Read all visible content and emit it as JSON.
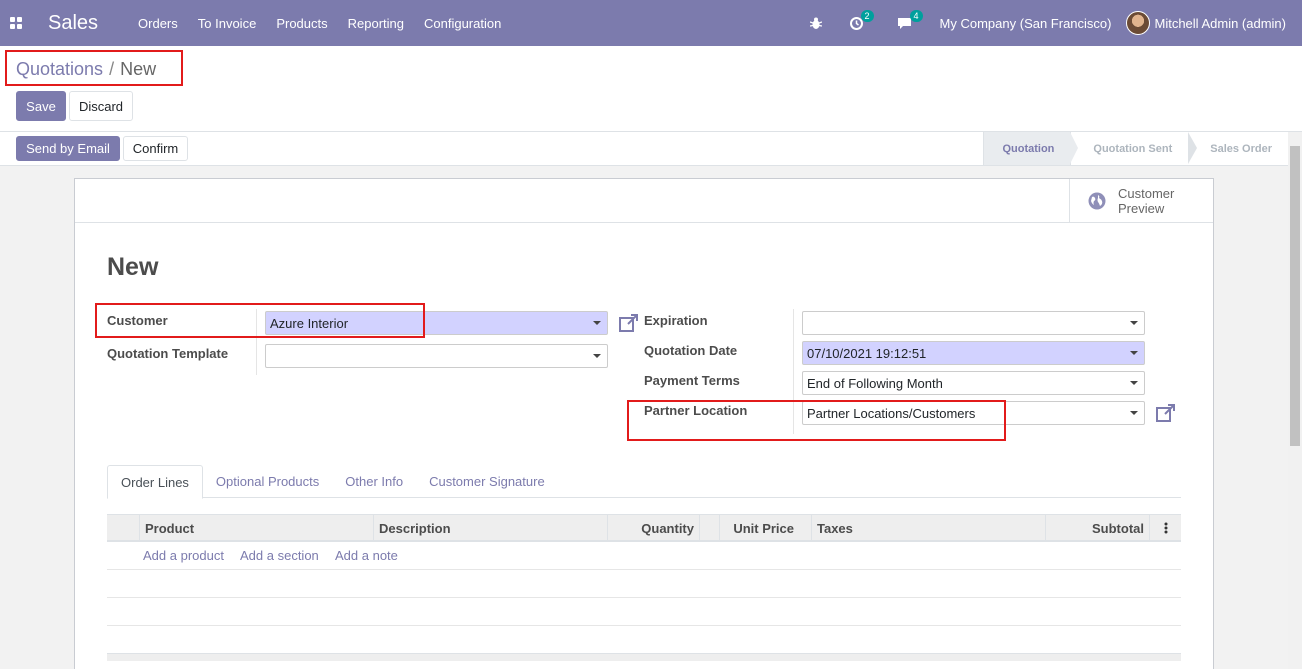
{
  "navbar": {
    "app_name": "Sales",
    "menu": [
      "Orders",
      "To Invoice",
      "Products",
      "Reporting",
      "Configuration"
    ],
    "activity_count": "2",
    "messages_count": "4",
    "company": "My Company (San Francisco)",
    "user": "Mitchell Admin (admin)"
  },
  "breadcrumb": {
    "parent": "Quotations",
    "separator": "/",
    "current": "New"
  },
  "actions": {
    "save": "Save",
    "discard": "Discard"
  },
  "statusbar": {
    "send_email": "Send by Email",
    "confirm": "Confirm",
    "stages": [
      {
        "label": "Quotation",
        "active": true
      },
      {
        "label": "Quotation Sent",
        "active": false
      },
      {
        "label": "Sales Order",
        "active": false
      }
    ]
  },
  "sheet": {
    "customer_preview": [
      "Customer",
      "Preview"
    ],
    "title": "New",
    "left_fields": {
      "customer": {
        "label": "Customer",
        "value": "Azure Interior"
      },
      "quotation_template": {
        "label": "Quotation Template",
        "value": ""
      }
    },
    "right_fields": {
      "expiration": {
        "label": "Expiration",
        "value": ""
      },
      "quotation_date": {
        "label": "Quotation Date",
        "value": "07/10/2021 19:12:51"
      },
      "payment_terms": {
        "label": "Payment Terms",
        "value": "End of Following Month"
      },
      "partner_location": {
        "label": "Partner Location",
        "value": "Partner Locations/Customers"
      }
    },
    "tabs": [
      "Order Lines",
      "Optional Products",
      "Other Info",
      "Customer Signature"
    ],
    "table": {
      "columns": [
        "Product",
        "Description",
        "Quantity",
        "Unit Price",
        "Taxes",
        "Subtotal"
      ],
      "add_links": [
        "Add a product",
        "Add a section",
        "Add a note"
      ]
    }
  },
  "colors": {
    "brand": "#7c7bad",
    "highlight": "#d2d2ff",
    "annotation": "#e21b1b"
  }
}
